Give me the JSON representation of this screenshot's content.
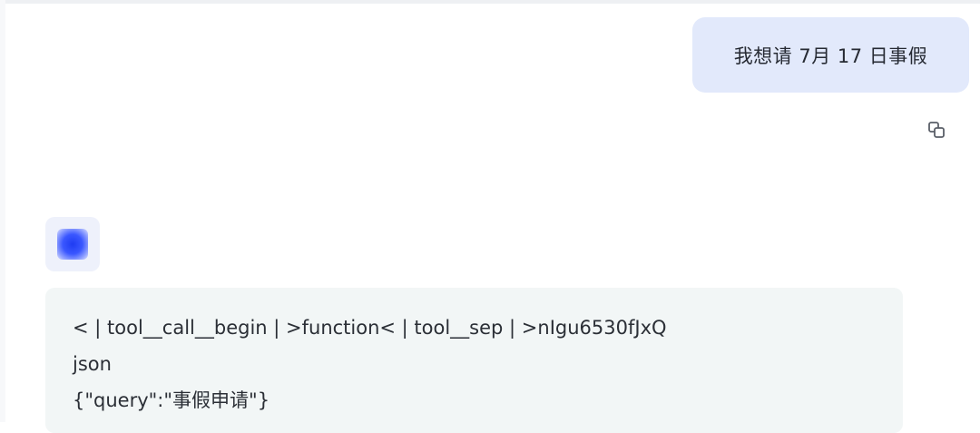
{
  "conversation": {
    "user_message": "我想请 7月 17 日事假",
    "assistant_message": {
      "lines": [
        "< | tool__call__begin | >function< | tool__sep | >nIgu6530fJxQ",
        "json",
        "{\"query\":\"事假申请\"}"
      ]
    }
  },
  "icons": {
    "copy": "copy-icon",
    "avatar": "assistant-logo-icon"
  },
  "colors": {
    "user_bubble_bg": "#e2e9fb",
    "assistant_bubble_bg": "#f2f6f6",
    "avatar_accent": "#2e4cff"
  }
}
